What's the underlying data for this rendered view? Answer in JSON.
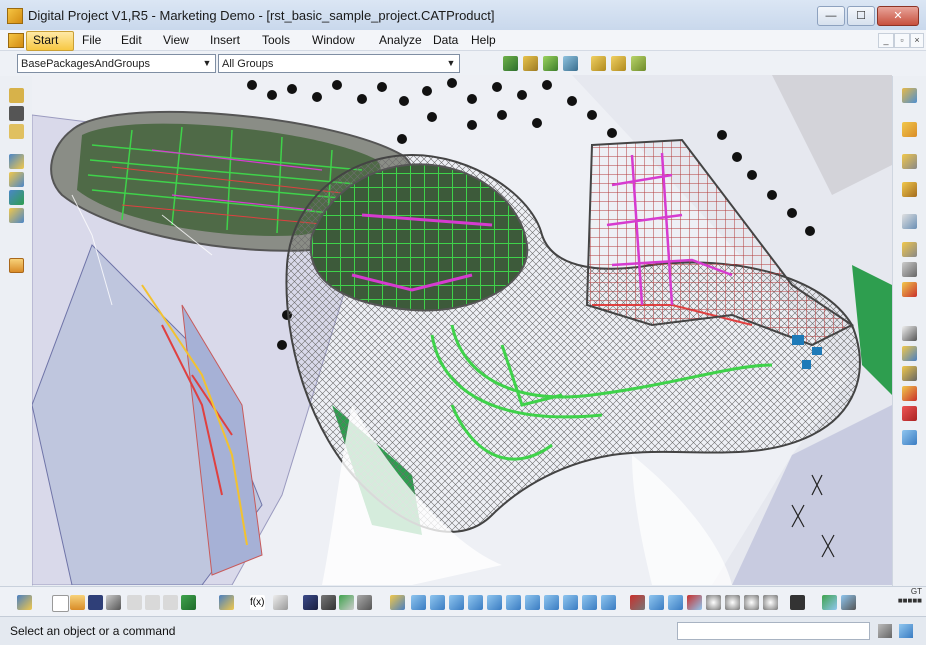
{
  "window": {
    "title": "Digital Project V1,R5 - Marketing Demo - [rst_basic_sample_project.CATProduct]",
    "controls": {
      "minimize": "—",
      "maximize": "☐",
      "close": "✕"
    }
  },
  "menubar": {
    "items": [
      {
        "label": "Start"
      },
      {
        "label": "File"
      },
      {
        "label": "Edit"
      },
      {
        "label": "View"
      },
      {
        "label": "Insert"
      },
      {
        "label": "Tools"
      },
      {
        "label": "Window"
      },
      {
        "label": "Analyze"
      },
      {
        "label": "Data"
      },
      {
        "label": "Help"
      }
    ],
    "mdi_controls": {
      "minimize": "_",
      "restore": "▫",
      "close": "×"
    }
  },
  "selectors": {
    "package": {
      "value": "BasePackagesAndGroups"
    },
    "group": {
      "value": "All Groups"
    }
  },
  "statusbar": {
    "message": "Select an object or a command",
    "command_input": {
      "value": "",
      "placeholder": ""
    }
  },
  "compass_label": "GT\n■■■■■",
  "colors": {
    "accent_start": "#f7c843",
    "titlebar": "#c9d8ec",
    "close_button": "#c7503d",
    "wireframe_green": "#3fd24a",
    "wireframe_magenta": "#d63bd0",
    "ground_green": "#2e9e4f"
  }
}
